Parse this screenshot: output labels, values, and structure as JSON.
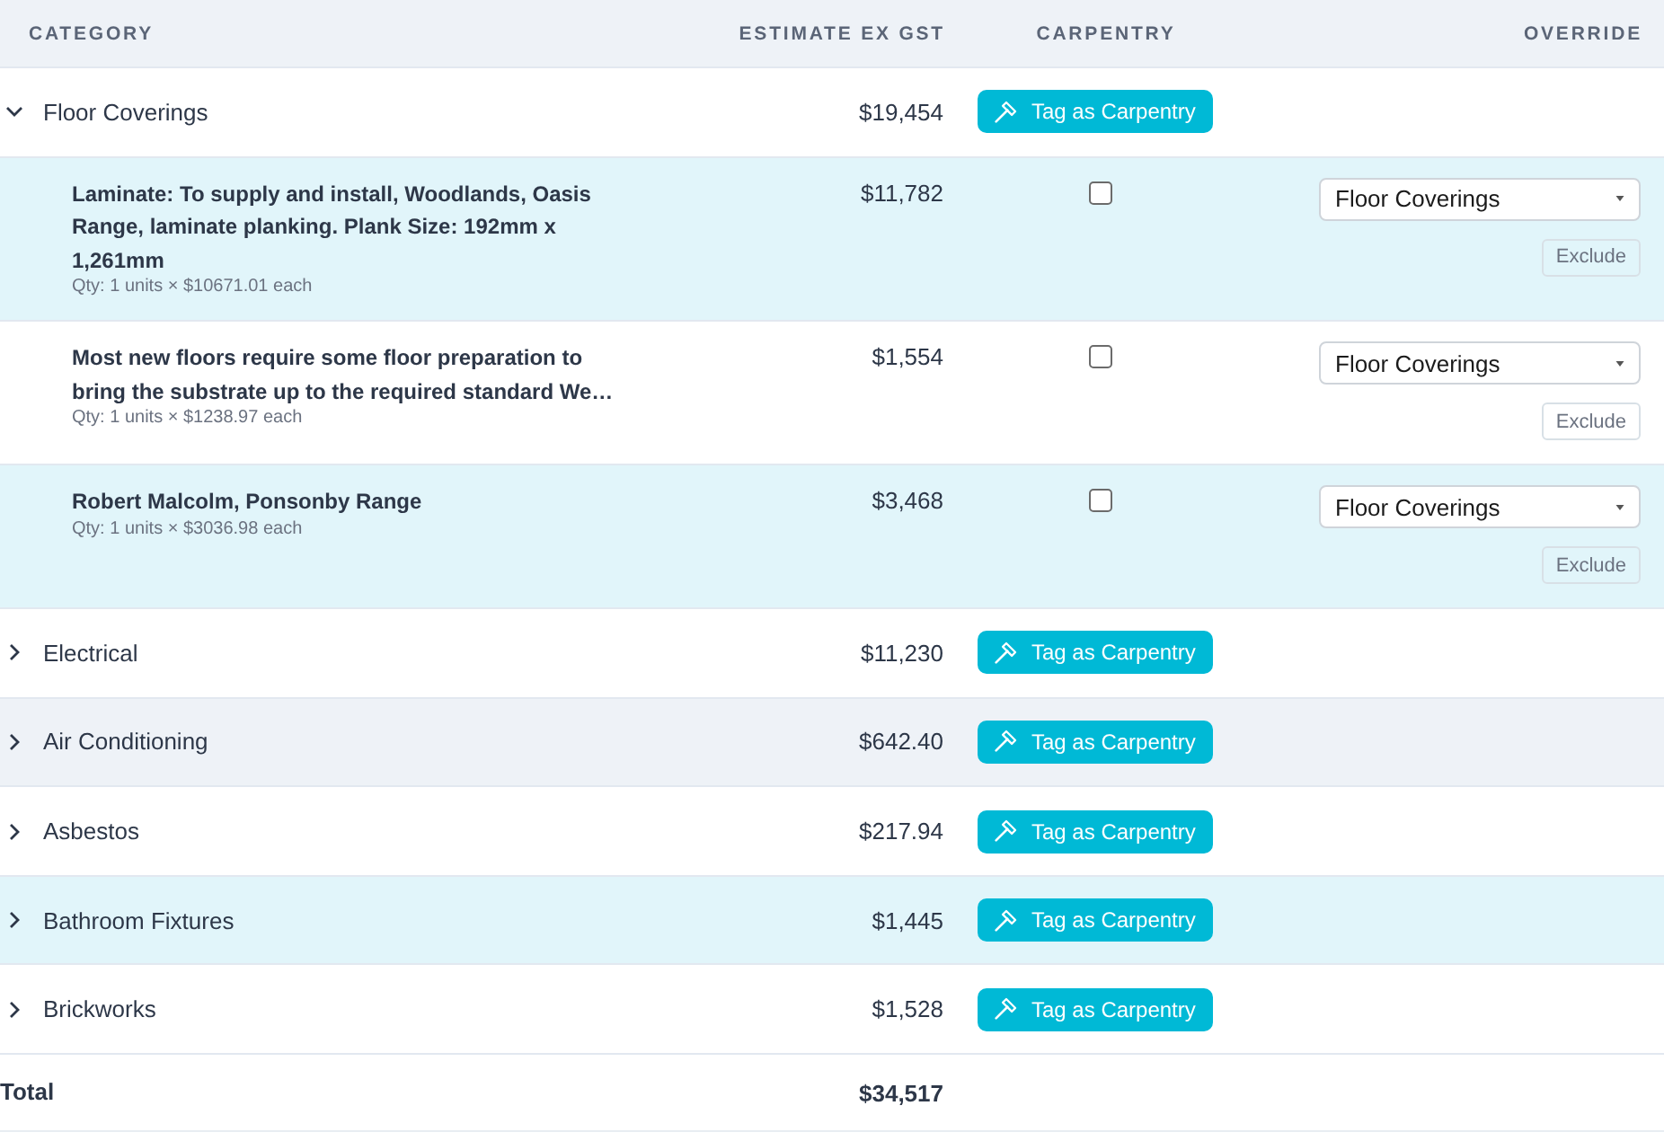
{
  "table": {
    "columns": [
      "CATEGORY",
      "ESTIMATE EX GST",
      "CARPENTRY",
      "OVERRIDE"
    ],
    "rows": [
      {
        "name": "Floor Coverings",
        "estimate": "$19,454",
        "tag_button": "Tag as Carpentry",
        "expanded": true,
        "hovered": false,
        "children": [
          {
            "description": "Laminate: To supply and install, Woodlands, Oasis Range, laminate planking. Plank Size: 192mm x 1,261mm",
            "quantity": "Qty: 1 units × $10671.01 each",
            "estimate": "$11,782",
            "checked": false,
            "override": "Floor Coverings",
            "exclude_button": "Exclude"
          },
          {
            "description": "Most new floors require some floor preparation to bring the substrate up to the required standard We…",
            "quantity": "Qty: 1 units × $1238.97 each",
            "estimate": "$1,554",
            "checked": false,
            "override": "Floor Coverings",
            "exclude_button": "Exclude"
          },
          {
            "description": "Robert Malcolm, Ponsonby Range",
            "quantity": "Qty: 1 units × $3036.98 each",
            "estimate": "$3,468",
            "checked": false,
            "override": "Floor Coverings",
            "exclude_button": "Exclude"
          }
        ]
      },
      {
        "name": "Electrical",
        "estimate": "$11,230",
        "tag_button": "Tag as Carpentry",
        "expanded": false,
        "hovered": false
      },
      {
        "name": "Air Conditioning",
        "estimate": "$642.40",
        "tag_button": "Tag as Carpentry",
        "expanded": false,
        "hovered": true
      },
      {
        "name": "Asbestos",
        "estimate": "$217.94",
        "tag_button": "Tag as Carpentry",
        "expanded": false,
        "hovered": false
      },
      {
        "name": "Bathroom Fixtures",
        "estimate": "$1,445",
        "tag_button": "Tag as Carpentry",
        "expanded": false,
        "hovered": false
      },
      {
        "name": "Brickworks",
        "estimate": "$1,528",
        "tag_button": "Tag as Carpentry",
        "expanded": false,
        "hovered": false
      }
    ],
    "total": {
      "label": "Total",
      "estimate": "$34,517"
    }
  }
}
